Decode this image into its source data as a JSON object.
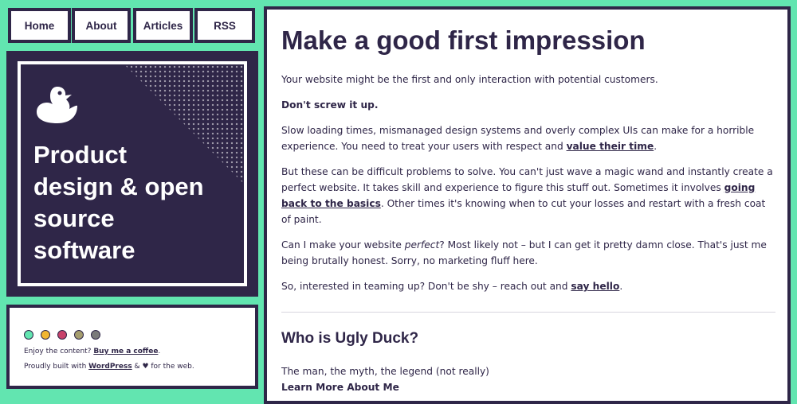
{
  "nav": {
    "home": "Home",
    "about": "About",
    "articles": "Articles",
    "rss": "RSS"
  },
  "hero": {
    "icon": "duck-icon",
    "title": "Product\ndesign & open\nsource\nsoftware"
  },
  "footer": {
    "color_dots": [
      "#62e5b0",
      "#f2b632",
      "#c8426b",
      "#a59d6e",
      "#7a7a7a"
    ],
    "enjoy_text": "Enjoy the content? ",
    "coffee_link": "Buy me a coffee",
    "enjoy_end": ".",
    "built_text": "Proudly built with ",
    "wordpress_link": "WordPress",
    "built_amp": " & ",
    "heart": "♥",
    "built_end": " for the web."
  },
  "main": {
    "title": "Make a good first impression",
    "p1": "Your website might be the first and only interaction with potential customers.",
    "p2": "Don't screw it up.",
    "p3_a": "Slow loading times, mismanaged design systems and overly complex UIs can make for a horrible experience. You need to treat your users with respect and ",
    "p3_link": "value their time",
    "p3_b": ".",
    "p4_a": "But these can be difficult problems to solve. You can't just wave a magic wand and instantly create a perfect website. It takes skill and experience to figure this stuff out. Sometimes it involves ",
    "p4_link": "going back to the basics",
    "p4_b": ". Other times it's knowing when to cut your losses and restart with a fresh coat of paint.",
    "p5_a": "Can I make your website ",
    "p5_em": "perfect",
    "p5_b": "? Most likely not – but I can get it pretty damn close. That's just me being brutally honest. Sorry, no marketing fluff here.",
    "p6_a": "So, interested in teaming up? Don't be shy – reach out and ",
    "p6_link": "say hello",
    "p6_b": ".",
    "who_title": "Who is Ugly Duck?",
    "who_text": "The man, the myth, the legend (not really)",
    "learn_more": "Learn More About Me"
  }
}
